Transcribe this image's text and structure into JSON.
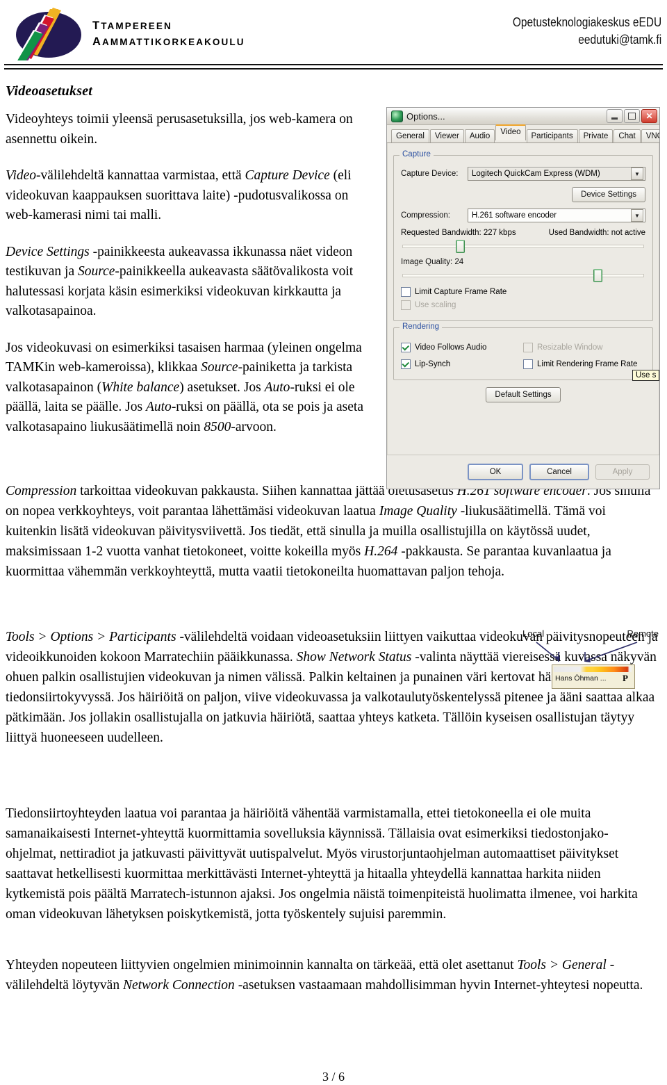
{
  "header": {
    "org_line1": "TAMPEREEN",
    "org_line2": "AMMATTIKORKEAKOULU",
    "contact_line1": "Opetusteknologiakeskus eEDU",
    "contact_line2": "eedutuki@tamk.fi"
  },
  "document": {
    "section_title": "Videoasetukset",
    "page_number": "3 / 6",
    "paragraphs": {
      "p1": "Videoyhteys toimii yleensä perusasetuksilla, jos web-kamera on asennettu oikein.",
      "p2_a": "Video",
      "p2_b": "-välilehdeltä kannattaa varmistaa, että ",
      "p2_c": "Capture Device",
      "p2_d": " (eli videokuvan kaappauksen suorittava laite) -pudotusvalikossa on web-kamerasi nimi tai malli.",
      "p3_a": "Device Settings",
      "p3_b": " -painikkeesta aukeavassa ikkunassa näet videon testikuvan ja ",
      "p3_c": "Source",
      "p3_d": "-painikkeella aukeavasta säätövalikosta voit halutessasi korjata käsin esimerkiksi videokuvan kirkkautta ja valkotasapainoa.",
      "p4_a": "Jos videokuvasi on esimerkiksi tasaisen harmaa (yleinen ongelma TAMKin web-kameroissa), klikkaa ",
      "p4_b": "Source",
      "p4_c": "-painiketta ja tarkista valkotasapainon (",
      "p4_d": "White balance",
      "p4_e": ") asetukset. Jos ",
      "p4_f": "Auto",
      "p4_g": "-ruksi ei ole päällä, laita se päälle. Jos ",
      "p4_h": "Auto",
      "p4_i": "-ruksi on päällä, ota se pois ja aseta valkotasapaino liukusäätimellä noin ",
      "p4_j": "8500",
      "p4_k": "-arvoon.",
      "p5_a": "Compression",
      "p5_b": " tarkoittaa videokuvan pakkausta. Siihen kannattaa jättää oletusasetus ",
      "p5_c": "H.261 software encoder",
      "p5_d": ". Jos sinulla on nopea verkkoyhteys, voit parantaa lähettämäsi videokuvan laatua ",
      "p5_e": "Image Quality",
      "p5_f": " -liukusäätimellä. Tämä voi kuitenkin lisätä videokuvan päivitysviivettä. Jos tiedät, että sinulla ja muilla osallistujilla on käytössä uudet, maksimissaan 1-2 vuotta vanhat tietokoneet, voitte kokeilla myös ",
      "p5_g": "H.264",
      "p5_h": " -pakkausta. Se parantaa kuvanlaatua ja kuormittaa vähemmän verkkoyhteyttä, mutta vaatii tietokoneilta huomattavan paljon tehoja.",
      "p6_a": "Tools > Options > Participants",
      "p6_b": " -välilehdeltä voidaan videoasetuksiin liittyen vaikuttaa videokuvan päivitysnopeuteen ja videoikkunoiden kokoon Marratechiin pääikkunassa. ",
      "p6_c": "Show Network Status",
      "p6_d": " -valinta näyttää viereisessä kuvassa näkyvän ohuen palkin osallistujien videokuvan ja nimen välissä. Palkin keltainen ja punainen väri kertovat häiriöistä verkon tiedonsiirtokyvyssä. Jos häiriöitä on paljon, viive videokuvassa ja valkotaulutyöskentelyssä pitenee ja ääni saattaa alkaa pätkimään. Jos jollakin osallistujalla on jatkuvia häiriötä, saattaa yhteys katketa. Tällöin kyseisen osallistujan täytyy liittyä huoneeseen uudelleen.",
      "p7": "Tiedonsiirtoyhteyden laatua voi parantaa ja häiriöitä vähentää varmistamalla, ettei tietokoneella ei ole muita samanaikaisesti Internet-yhteyttä kuormittamia sovelluksia käynnissä. Tällaisia ovat esimerkiksi tiedostonjako-ohjelmat, nettiradiot ja jatkuvasti päivittyvät uutispalvelut. Myös virustorjuntaohjelman automaattiset päivitykset saattavat hetkellisesti kuormittaa merkittävästi Internet-yhteyttä ja hitaalla yhteydellä kannattaa harkita niiden kytkemistä pois päältä Marratech-istunnon ajaksi. Jos ongelmia näistä toimenpiteistä huolimatta ilmenee, voi harkita oman videokuvan lähetyksen poiskytkemistä, jotta työskentely sujuisi paremmin.",
      "p8_a": "Yhteyden nopeuteen liittyvien ongelmien minimoinnin kannalta on tärkeää, että olet asettanut ",
      "p8_b": "Tools > General",
      "p8_c": " -välilehdeltä löytyvän ",
      "p8_d": "Network Connection",
      "p8_e": " -asetuksen vastaamaan mahdollisimman hyvin Internet-yhteytesi nopeutta."
    }
  },
  "options_dialog": {
    "title": "Options...",
    "window_buttons": {
      "minimize": "_",
      "maximize": "□",
      "close": "✕"
    },
    "tabs": [
      {
        "label": "General",
        "active": false
      },
      {
        "label": "Viewer",
        "active": false
      },
      {
        "label": "Audio",
        "active": false
      },
      {
        "label": "Video",
        "active": true
      },
      {
        "label": "Participants",
        "active": false
      },
      {
        "label": "Private",
        "active": false
      },
      {
        "label": "Chat",
        "active": false
      },
      {
        "label": "VNC",
        "active": false
      }
    ],
    "capture_group": {
      "legend": "Capture",
      "capture_device_label": "Capture Device:",
      "capture_device_value": "Logitech QuickCam Express (WDM)",
      "device_settings_button": "Device Settings",
      "compression_label": "Compression:",
      "compression_value": "H.261 software encoder",
      "requested_bandwidth": "Requested Bandwidth: 227 kbps",
      "used_bandwidth": "Used Bandwidth: not active",
      "bandwidth_slider_pct": 22,
      "image_quality_label": "Image Quality: 24",
      "image_quality_slider_pct": 79,
      "limit_capture_frame_rate": "Limit Capture Frame Rate",
      "limit_capture_frame_rate_checked": false,
      "use_scaling": "Use scaling",
      "use_scaling_checked": false,
      "use_scaling_disabled": true
    },
    "rendering_group": {
      "legend": "Rendering",
      "video_follows_audio": "Video Follows Audio",
      "video_follows_audio_checked": true,
      "lip_synch": "Lip-Synch",
      "lip_synch_checked": true,
      "resizable_window": "Resizable Window",
      "resizable_window_checked": false,
      "resizable_window_disabled": true,
      "limit_rendering_frame_rate": "Limit Rendering Frame Rate",
      "limit_rendering_frame_rate_checked": false
    },
    "default_settings_button": "Default Settings",
    "footer_buttons": {
      "ok": "OK",
      "cancel": "Cancel",
      "apply": "Apply"
    },
    "tooltip": "Use s"
  },
  "network_status_inset": {
    "local_label": "Local",
    "remote_label": "Remote",
    "participant_name": "Hans Öhman ...",
    "participant_flag": "P"
  },
  "colors": {
    "logo_navy": "#231a53",
    "logo_yellow": "#f0b323",
    "logo_red": "#d4142c",
    "logo_purple": "#7b1f7a",
    "logo_green": "#119347",
    "dialog_bg": "#eceae4",
    "tab_active_accent": "#f0a52a",
    "group_legend": "#2a4fa0"
  }
}
